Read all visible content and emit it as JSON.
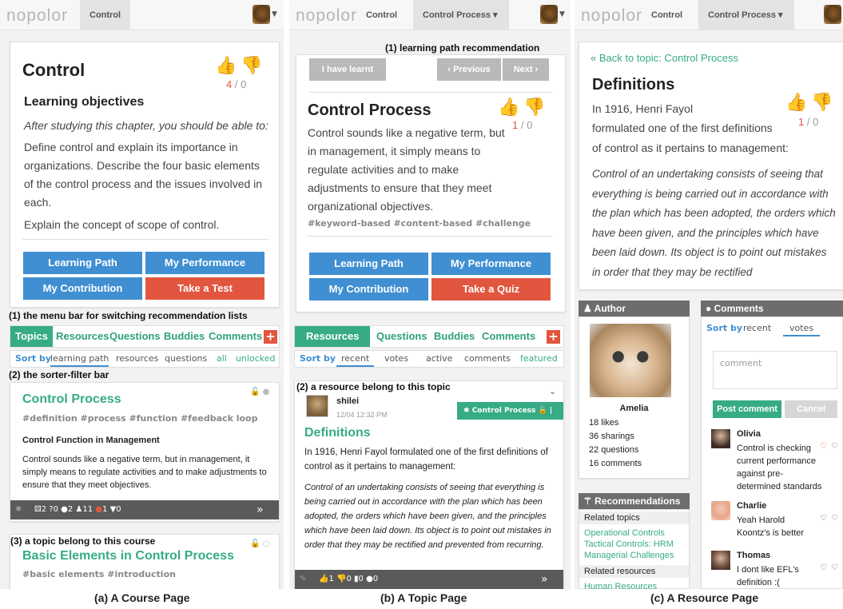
{
  "app": {
    "logo": "nopolor"
  },
  "course_page": {
    "tabs": [
      "Control"
    ],
    "title": "Control",
    "likes": "4",
    "dislikes": "0",
    "section_title": "Learning objectives",
    "intro": "After studying this chapter, you should be able to:",
    "objective1": "Define control and explain its importance in organizations. Describe the four basic elements of the control process and the issues involved in each.",
    "objective2": "Explain the concept of scope of control.",
    "buttons": {
      "learning_path": "Learning Path",
      "my_performance": "My Performance",
      "my_contribution": "My Contribution",
      "take_test": "Take a Test"
    },
    "ann1": "(1) the menu bar for switching recommendation lists",
    "menu": {
      "topics": "Topics",
      "resources": "Resources",
      "questions": "Questions",
      "buddies": "Buddies",
      "comments": "Comments"
    },
    "ann2": "(2) the sorter-filter bar",
    "sorter": {
      "label": "Sort by",
      "learning_path": "learning path",
      "resources": "resources",
      "questions": "questions",
      "all": "all",
      "unlocked": "unlocked"
    },
    "topic1": {
      "title": "Control Process",
      "tags": "#definition #process #function #feedback loop",
      "subtitle": "Control Function in Management",
      "body": "Control sounds like a negative term, but in management, it simply means to regulate activities and to make adjustments to ensure that they meet objectives.",
      "stats": {
        "res": "2",
        "q": "0",
        "c": "2",
        "b": "11",
        "up": "1",
        "dn": "0"
      }
    },
    "ann3": "(3) a topic belong to this course",
    "topic2": {
      "title": "Basic Elements in Control Process",
      "tags": "#basic elements #introduction"
    },
    "caption": "(a) A Course Page"
  },
  "topic_page": {
    "tabs": [
      "Control",
      "Control Process"
    ],
    "ann1": "(1) learning path recommendation",
    "learnt": "I have learnt",
    "previous": "Previous",
    "next": "Next",
    "title": "Control Process",
    "likes": "1",
    "dislikes": "0",
    "body": "Control sounds like a negative term, but in management, it simply means to regulate activities and to make adjustments to ensure that they meet organizational objectives.",
    "tags": "#keyword-based #content-based #challenge",
    "buttons": {
      "learning_path": "Learning Path",
      "my_performance": "My Performance",
      "my_contribution": "My Contribution",
      "take_quiz": "Take a Quiz"
    },
    "menu": {
      "resources": "Resources",
      "questions": "Questions",
      "buddies": "Buddies",
      "comments": "Comments"
    },
    "sorter": {
      "label": "Sort by",
      "recent": "recent",
      "votes": "votes",
      "active": "active",
      "comments": "comments",
      "featured": "featured"
    },
    "ann2": "(2) a resource belong to this topic",
    "resource": {
      "user": "shilei",
      "time": "12/04 12:32 PM",
      "badge": "Control Process",
      "title": "Definitions",
      "body": "In 1916, Henri Fayol formulated one of the first definitions of control as it pertains to management:",
      "quote": "Control of an undertaking consists of seeing that everything is being carried out in accordance with the plan which has been adopted, the orders which have been given, and the principles which have been laid down. Its object is to point out mistakes in order that they may be rectified and prevented from recurring.",
      "stats": {
        "up": "1",
        "dn": "0",
        "bm": "0",
        "c": "0"
      }
    },
    "caption": "(b) A Topic Page"
  },
  "resource_page": {
    "tabs": [
      "Control",
      "Control Process"
    ],
    "back": "« Back to topic: Control Process",
    "title": "Definitions",
    "likes": "1",
    "dislikes": "0",
    "line1": "In 1916, Henri Fayol",
    "line2": "formulated one of the first definitions",
    "line3": "of control as it pertains to management:",
    "quote": "Control of an undertaking consists of seeing that everything is being carried out in accordance with the plan which has been adopted, the orders which have been given, and the principles which have been laid down. Its object is to point out mistakes in order that they may be rectified",
    "author_head": "Author",
    "author_name": "Amelia",
    "author_stats": [
      "18 likes",
      "36 sharings",
      "22 questions",
      "16 comments"
    ],
    "rec_head": "Recommendations",
    "related_topics": "Related topics",
    "rt_links": [
      "Operational Controls",
      "Tactical Controls: HRM",
      "Managerial Challenges"
    ],
    "related_resources": "Related resources",
    "rr_link": "Human Resources",
    "comments_head": "Comments",
    "sort_label": "Sort by",
    "sort_recent": "recent",
    "sort_votes": "votes",
    "comment_placeholder": "comment",
    "post": "Post comment",
    "cancel": "Cancel",
    "comments": [
      {
        "name": "Olivia",
        "text": "Control is checking current performance against pre-determined standards"
      },
      {
        "name": "Charlie",
        "text": "Yeah Harold Koontz's is better"
      },
      {
        "name": "Thomas",
        "text": "I dont like EFL's definition :("
      }
    ],
    "caption": "(c) A Resource Page"
  },
  "colors": {
    "green": "#36ab86",
    "blue": "#3f8fd2",
    "red": "#e2553e"
  }
}
